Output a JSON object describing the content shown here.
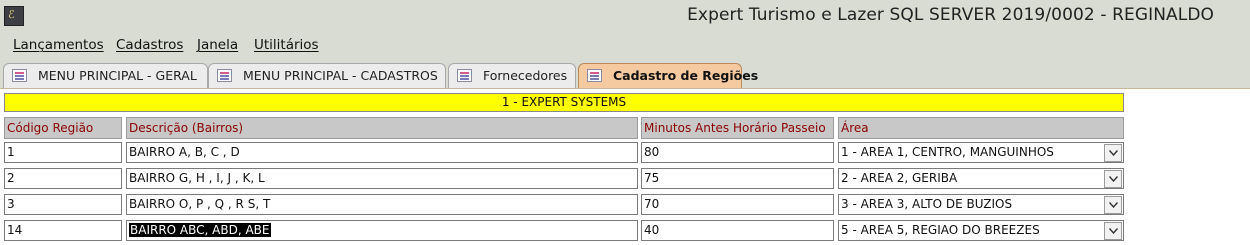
{
  "window": {
    "title": "Expert Turismo e Lazer SQL SERVER 2019/0002 - REGINALDO"
  },
  "menu": [
    {
      "label": "Lançamentos"
    },
    {
      "label": "Cadastros"
    },
    {
      "label": "Janela"
    },
    {
      "label": "Utilitários"
    }
  ],
  "tabs": [
    {
      "label": "MENU PRINCIPAL - GERAL",
      "active": false
    },
    {
      "label": "MENU PRINCIPAL - CADASTROS",
      "active": false
    },
    {
      "label": "Fornecedores",
      "active": false
    },
    {
      "label": "Cadastro de Regiões",
      "active": true
    }
  ],
  "company": "1 - EXPERT SYSTEMS",
  "columns": {
    "code": "Código Região",
    "description": "Descrição (Bairros)",
    "minutes": "Minutos Antes Horário Passeio",
    "area": "Área"
  },
  "rows": [
    {
      "code": "1",
      "description": "BAIRRO A, B, C , D",
      "minutes": "80",
      "area": "1 - AREA 1, CENTRO, MANGUINHOS"
    },
    {
      "code": "2",
      "description": "BAIRRO G, H , I, J , K, L",
      "minutes": "75",
      "area": "2 - AREA 2, GERIBA"
    },
    {
      "code": "3",
      "description": "BAIRRO O, P , Q , R S, T",
      "minutes": "70",
      "area": "3 - AREA 3, ALTO DE BUZIOS"
    },
    {
      "code": "14",
      "description": "BAIRRO ABC, ABD, ABE",
      "minutes": "40",
      "area": "5 - AREA 5, REGIAO DO BREEZES",
      "selected_description": true
    }
  ],
  "icons": {
    "app": "app-logo-icon",
    "tab": "form-icon",
    "dropdown": "chevron-down-icon"
  }
}
